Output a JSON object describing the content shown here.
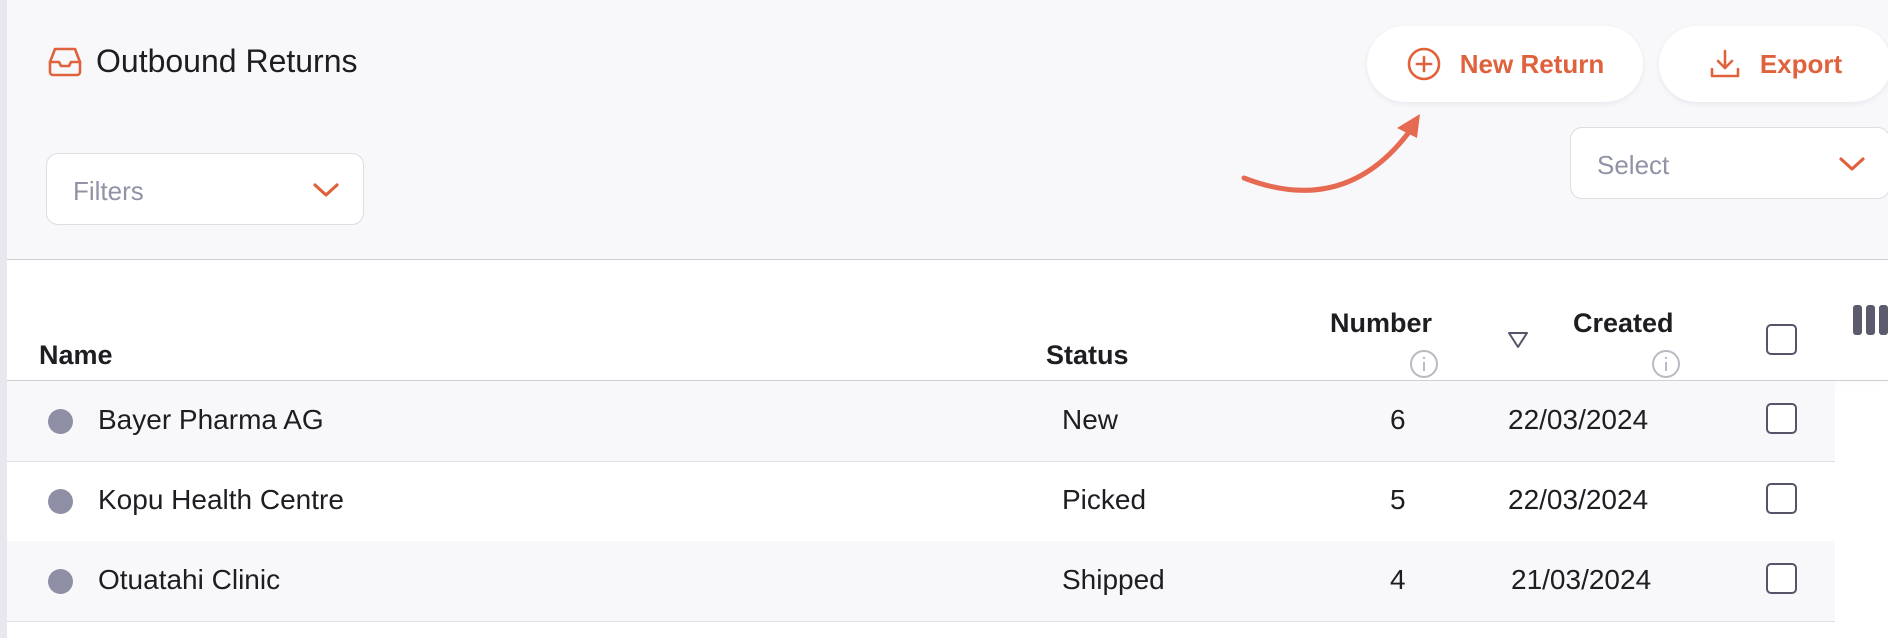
{
  "header": {
    "title": "Outbound Returns",
    "title_icon": "inbox-tray-icon"
  },
  "actions": {
    "new_return_label": "New Return",
    "export_label": "Export",
    "accent_color": "#e0623c"
  },
  "filters": {
    "placeholder": "Filters"
  },
  "select": {
    "placeholder": "Select"
  },
  "table": {
    "columns": {
      "name": "Name",
      "status": "Status",
      "number": "Number",
      "created": "Created"
    },
    "rows": [
      {
        "name": "Bayer Pharma AG",
        "status": "New",
        "number": "6",
        "created": "22/03/2024",
        "checked": false
      },
      {
        "name": "Kopu Health Centre",
        "status": "Picked",
        "number": "5",
        "created": "22/03/2024",
        "checked": false
      },
      {
        "name": "Otuatahi Clinic",
        "status": "Shipped",
        "number": "4",
        "created": "21/03/2024",
        "checked": false
      }
    ]
  }
}
